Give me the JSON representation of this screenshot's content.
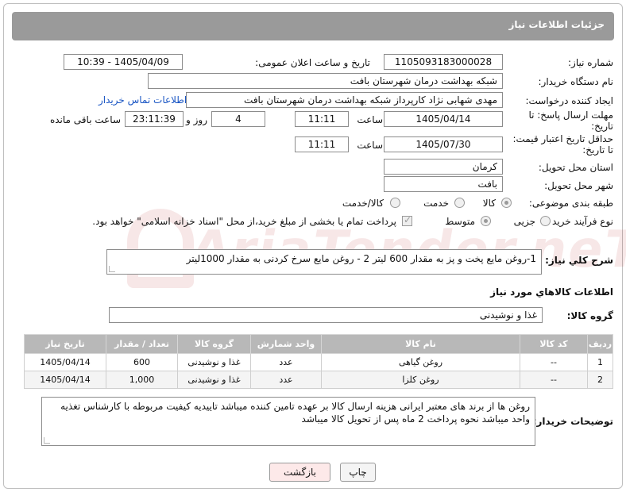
{
  "header": {
    "title": "جزئیات اطلاعات نیاز"
  },
  "form": {
    "need_number_label": "شماره نیاز:",
    "need_number": "1105093183000028",
    "announce_label": "تاریخ و ساعت اعلان عمومی:",
    "announce_value": "1405/04/09 - 10:39",
    "buyer_org_label": "نام دستگاه خریدار:",
    "buyer_org": "شبکه بهداشت درمان شهرستان بافت",
    "requester_label": "ایجاد کننده درخواست:",
    "requester": "مهدی شهابی نژاد کارپرداز شبکه بهداشت درمان شهرستان بافت",
    "contact_link": "اطلاعات تماس خریدار",
    "deadline_label_1": "مهلت ارسال پاسخ: تا",
    "deadline_label_2": "تاریخ:",
    "deadline_date": "1405/04/14",
    "time_label": "ساعت",
    "deadline_time": "11:11",
    "days_value": "4",
    "days_label": "روز و",
    "remaining_time": "23:11:39",
    "remaining_label": "ساعت باقی مانده",
    "validity_label_1": "حداقل تاریخ اعتبار قیمت:",
    "validity_label_2": "تا تاریخ:",
    "validity_date": "1405/07/30",
    "validity_time_label": "ساعت",
    "validity_time": "11:11",
    "province_label": "استان محل تحویل:",
    "province": "کرمان",
    "city_label": "شهر محل تحویل:",
    "city": "بافت",
    "category_label": "طبقه بندی موضوعی:",
    "category_options": [
      "کالا",
      "خدمت",
      "کالا/خدمت"
    ],
    "category_selected": "کالا",
    "process_label": "نوع فرآیند خرید :",
    "process_options": [
      "جزیی",
      "متوسط"
    ],
    "process_selected": "متوسط",
    "payment_note": "پرداخت تمام یا بخشی از مبلغ خرید،از محل \"اسناد خزانه اسلامی\" خواهد بود."
  },
  "description": {
    "label": "شرح کلي نياز:",
    "text": "1-روغن مایع پخت و پز به مقدار 600 لیتر 2 - روغن مایع سرخ کردنی به مقدار 1000لیتر"
  },
  "goods_info": {
    "title": "اطلاعات کالاهاي مورد نياز",
    "group_label": "گروه کالا:",
    "group_value": "غذا و نوشیدنی"
  },
  "table": {
    "headers": [
      "ردیف",
      "کد کالا",
      "نام کالا",
      "واحد شمارش",
      "گروه کالا",
      "تعداد / مقدار",
      "تاریخ نیاز"
    ],
    "rows": [
      [
        "1",
        "--",
        "روغن گیاهی",
        "عدد",
        "غذا و نوشیدنی",
        "600",
        "1405/04/14"
      ],
      [
        "2",
        "--",
        "روغن کلزا",
        "عدد",
        "غذا و نوشیدنی",
        "1,000",
        "1405/04/14"
      ]
    ]
  },
  "buyer_notes": {
    "label": "توضیحات خریدار:",
    "text": "روغن ها از برند های معتبر ایرانی  هزینه ارسال کالا بر عهده تامین کننده میباشد تاییدیه کیفیت مربوطه با کارشناس تغذیه واحد میباشد  نحوه پرداخت 2 ماه پس از تحویل کالا میباشد"
  },
  "buttons": {
    "print": "چاپ",
    "back": "بازگشت"
  },
  "watermark": {
    "text": "AriaTender.neT"
  }
}
